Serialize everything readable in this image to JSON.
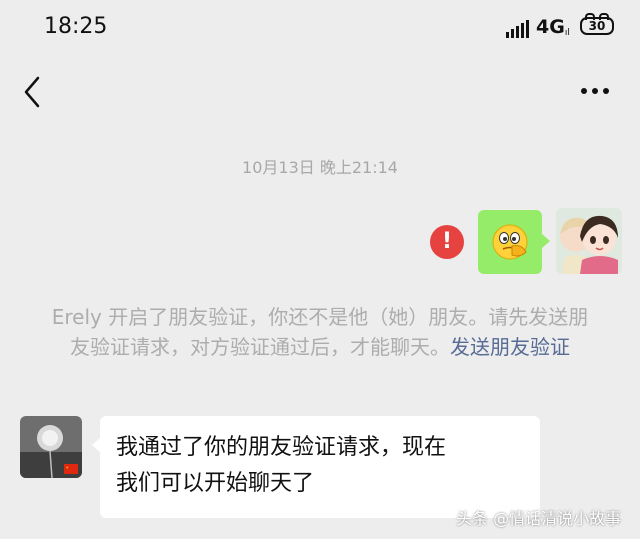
{
  "status_bar": {
    "time": "18:25",
    "network": "4G",
    "network_sub": "ıl",
    "battery": "30"
  },
  "nav": {
    "back_icon": "chevron-left-icon",
    "more_icon": "ellipsis-icon"
  },
  "chat": {
    "timestamp": "10月13日 晚上21:14",
    "sent_message": {
      "type": "emoji",
      "emoji_icon": "facepalm-emoji-icon",
      "status_icon": "send-failed-icon",
      "bubble_color": "#95ec69"
    },
    "system_notice": {
      "text": "Erely 开启了朋友验证，你还不是他（她）朋友。请先发送朋友验证请求，对方验证通过后，才能聊天。",
      "link_text": "发送朋友验证",
      "link_color": "#576b95"
    },
    "received_message": {
      "line1": "我通过了你的朋友验证请求，现在",
      "line2": "我们可以开始聊天了"
    }
  },
  "watermark": "头条 @情话清说小故事",
  "colors": {
    "background": "#ededed",
    "error": "#e64340"
  }
}
